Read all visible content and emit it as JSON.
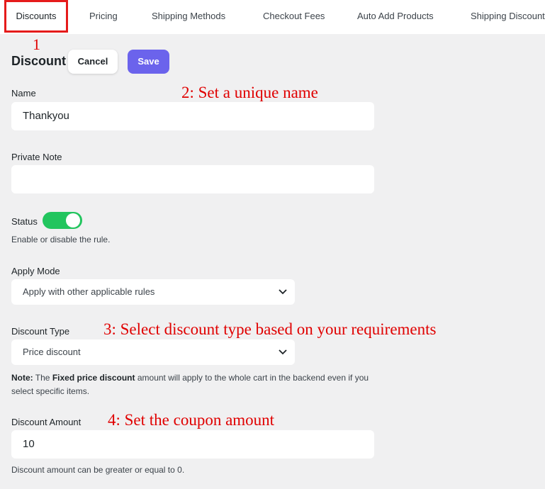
{
  "tabs": [
    {
      "label": "Discounts",
      "active": true
    },
    {
      "label": "Pricing"
    },
    {
      "label": "Shipping Methods"
    },
    {
      "label": "Checkout Fees"
    },
    {
      "label": "Auto Add Products"
    },
    {
      "label": "Shipping Discount"
    }
  ],
  "annotations": {
    "a1": "1",
    "a2": "2: Set a unique name",
    "a3": "3: Select discount type based on your requirements",
    "a4": "4: Set the coupon amount"
  },
  "header": {
    "title": "Discount",
    "cancel_label": "Cancel",
    "save_label": "Save"
  },
  "form": {
    "name_label": "Name",
    "name_value": "Thankyou",
    "note_label": "Private Note",
    "note_value": "",
    "status_label": "Status",
    "status_on": true,
    "status_help": "Enable or disable the rule.",
    "apply_mode_label": "Apply Mode",
    "apply_mode_value": "Apply with other applicable rules",
    "discount_type_label": "Discount Type",
    "discount_type_value": "Price discount",
    "note_prefix": "Note:",
    "note_text1": " The ",
    "note_bold": "Fixed price discount",
    "note_text2": " amount will apply to the whole cart in the backend even if you select specific items.",
    "amount_label": "Discount Amount",
    "amount_value": "10",
    "amount_help": "Discount amount can be greater or equal to 0."
  },
  "colors": {
    "accent": "#6b63ec",
    "toggle_on": "#22c55e",
    "annotation": "#e00000",
    "highlight_box": "#e51b1b"
  },
  "icons": {
    "select_chevron": "chevron-down-icon"
  }
}
